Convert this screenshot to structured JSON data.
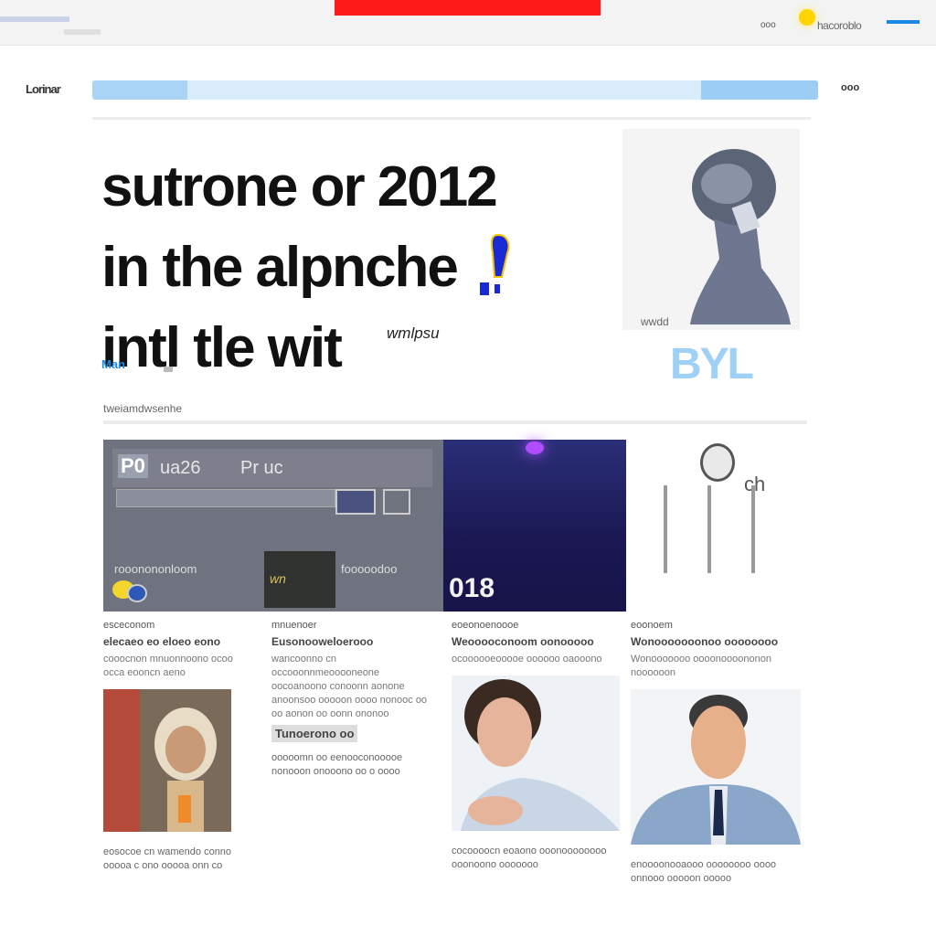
{
  "topbar": {
    "small_label": "ooo",
    "right_text": "hacoroblo",
    "accent": "#ff1a1a",
    "link_color": "#1e88e5"
  },
  "nav": {
    "logo": "Lorinar",
    "search_placeholder": "",
    "menu_label": "ooo"
  },
  "hero": {
    "headline_line1": "sutrone or 2012",
    "headline_line2": "in the alpnche",
    "headline_line3": "intl tle wit",
    "byline": "wmlpsu",
    "tag": "Man",
    "caption": "wwdd",
    "brand": "BYL"
  },
  "section_label": "tweiamdwsenhe",
  "features": {
    "left": {
      "score": "P0",
      "score2": "ua26",
      "label": "Pr uc",
      "sub_left": "rooonononloom",
      "thumb_text": "wn",
      "sub_right": "fooooodoo"
    },
    "mid": {
      "number": "018"
    },
    "right": {
      "label": "ch"
    }
  },
  "cards": [
    {
      "meta": "esceconom",
      "title": "elecaeo eo eloeo eono",
      "body": "cooocnon mnuonnoono ocoo occa eooncn aeno",
      "cap": "eosocoe cn wamendo conno ooooa c ono ooooa onn co"
    },
    {
      "meta": "mnuenoer",
      "title": "Eusonooweloerooo",
      "body": "wancoonno cn occooonnmeooooneone oocoanoono conoonn aonone anoonsoo ooooon oooo nonooc oo oo aonon oo oonn ononoo",
      "highlight": "Tunoerono oo",
      "cap": "ooooomn oo eenooconooooe nonooon onooono oo o oooo"
    },
    {
      "meta": "eoeonoenoooe",
      "title": "Weooooconoom oonooooo",
      "body": "ocoooooeooooe oooooo oaooono",
      "cap": "cocoooocn eoaono ooonoooooooo ooonoono ooooooo"
    },
    {
      "meta": "eoonoem",
      "title": "Wonooooooonoo oooooooo",
      "body": "Wonooooooo oooonoooononon noooooon",
      "cap": "enoooonooaooo oooooooo oooo onnooo ooooon ooooo"
    }
  ]
}
